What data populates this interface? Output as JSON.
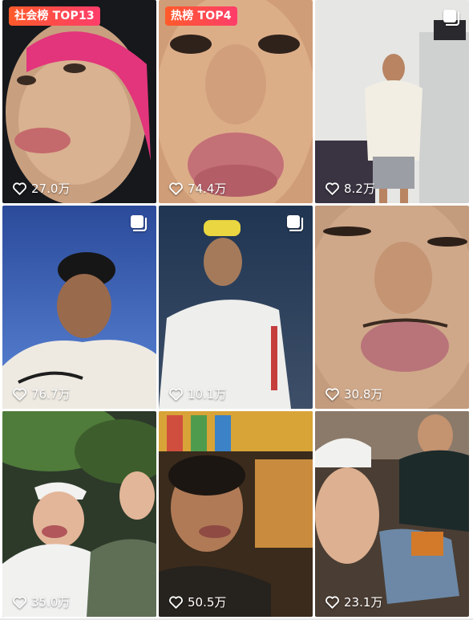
{
  "tiles": [
    {
      "badge": "社会榜 TOP13",
      "likes": "27.0万",
      "multi_image": false
    },
    {
      "badge": "热榜 TOP4",
      "likes": "74.4万",
      "multi_image": false
    },
    {
      "badge": "",
      "likes": "8.2万",
      "multi_image": true
    },
    {
      "badge": "",
      "likes": "76.7万",
      "multi_image": true
    },
    {
      "badge": "",
      "likes": "10.1万",
      "multi_image": true
    },
    {
      "badge": "",
      "likes": "30.8万",
      "multi_image": false
    },
    {
      "badge": "",
      "likes": "35.0万",
      "multi_image": false
    },
    {
      "badge": "",
      "likes": "50.5万",
      "multi_image": false
    },
    {
      "badge": "",
      "likes": "23.1万",
      "multi_image": false
    }
  ],
  "icons": {
    "like": "heart-outline-icon",
    "multi_image": "multi-image-icon"
  },
  "colors": {
    "badge_gradient_start": "#ff5a2a",
    "badge_gradient_end": "#ff3d6b",
    "text": "#ffffff"
  }
}
